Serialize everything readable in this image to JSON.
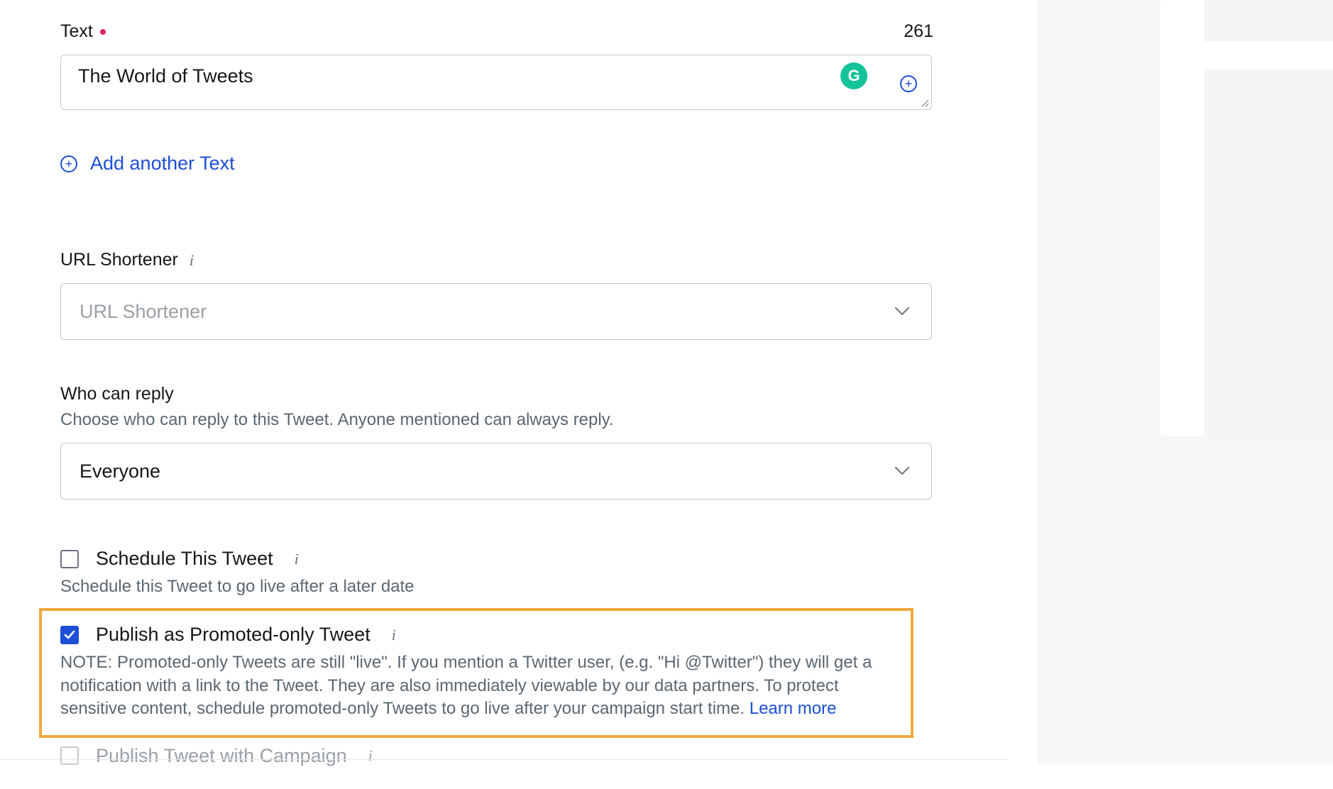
{
  "text_field": {
    "label": "Text",
    "count": "261",
    "value": "The World of Tweets",
    "grammarly_badge": "G"
  },
  "add_another": {
    "label": "Add another Text"
  },
  "url_shortener": {
    "label": "URL Shortener",
    "placeholder": "URL Shortener"
  },
  "who_can_reply": {
    "label": "Who can reply",
    "subtext": "Choose who can reply to this Tweet. Anyone mentioned can always reply.",
    "value": "Everyone"
  },
  "schedule": {
    "label": "Schedule This Tweet",
    "desc": "Schedule this Tweet to go live after a later date"
  },
  "promoted": {
    "label": "Publish as Promoted-only Tweet",
    "note": "NOTE: Promoted-only Tweets are still \"live\". If you mention a Twitter user, (e.g. \"Hi @Twitter\") they will get a notification with a link to the Tweet. They are also immediately viewable by our data partners. To protect sensitive content, schedule promoted-only Tweets to go live after your campaign start time. ",
    "learn_more": "Learn more"
  },
  "campaign": {
    "label": "Publish Tweet with Campaign"
  }
}
